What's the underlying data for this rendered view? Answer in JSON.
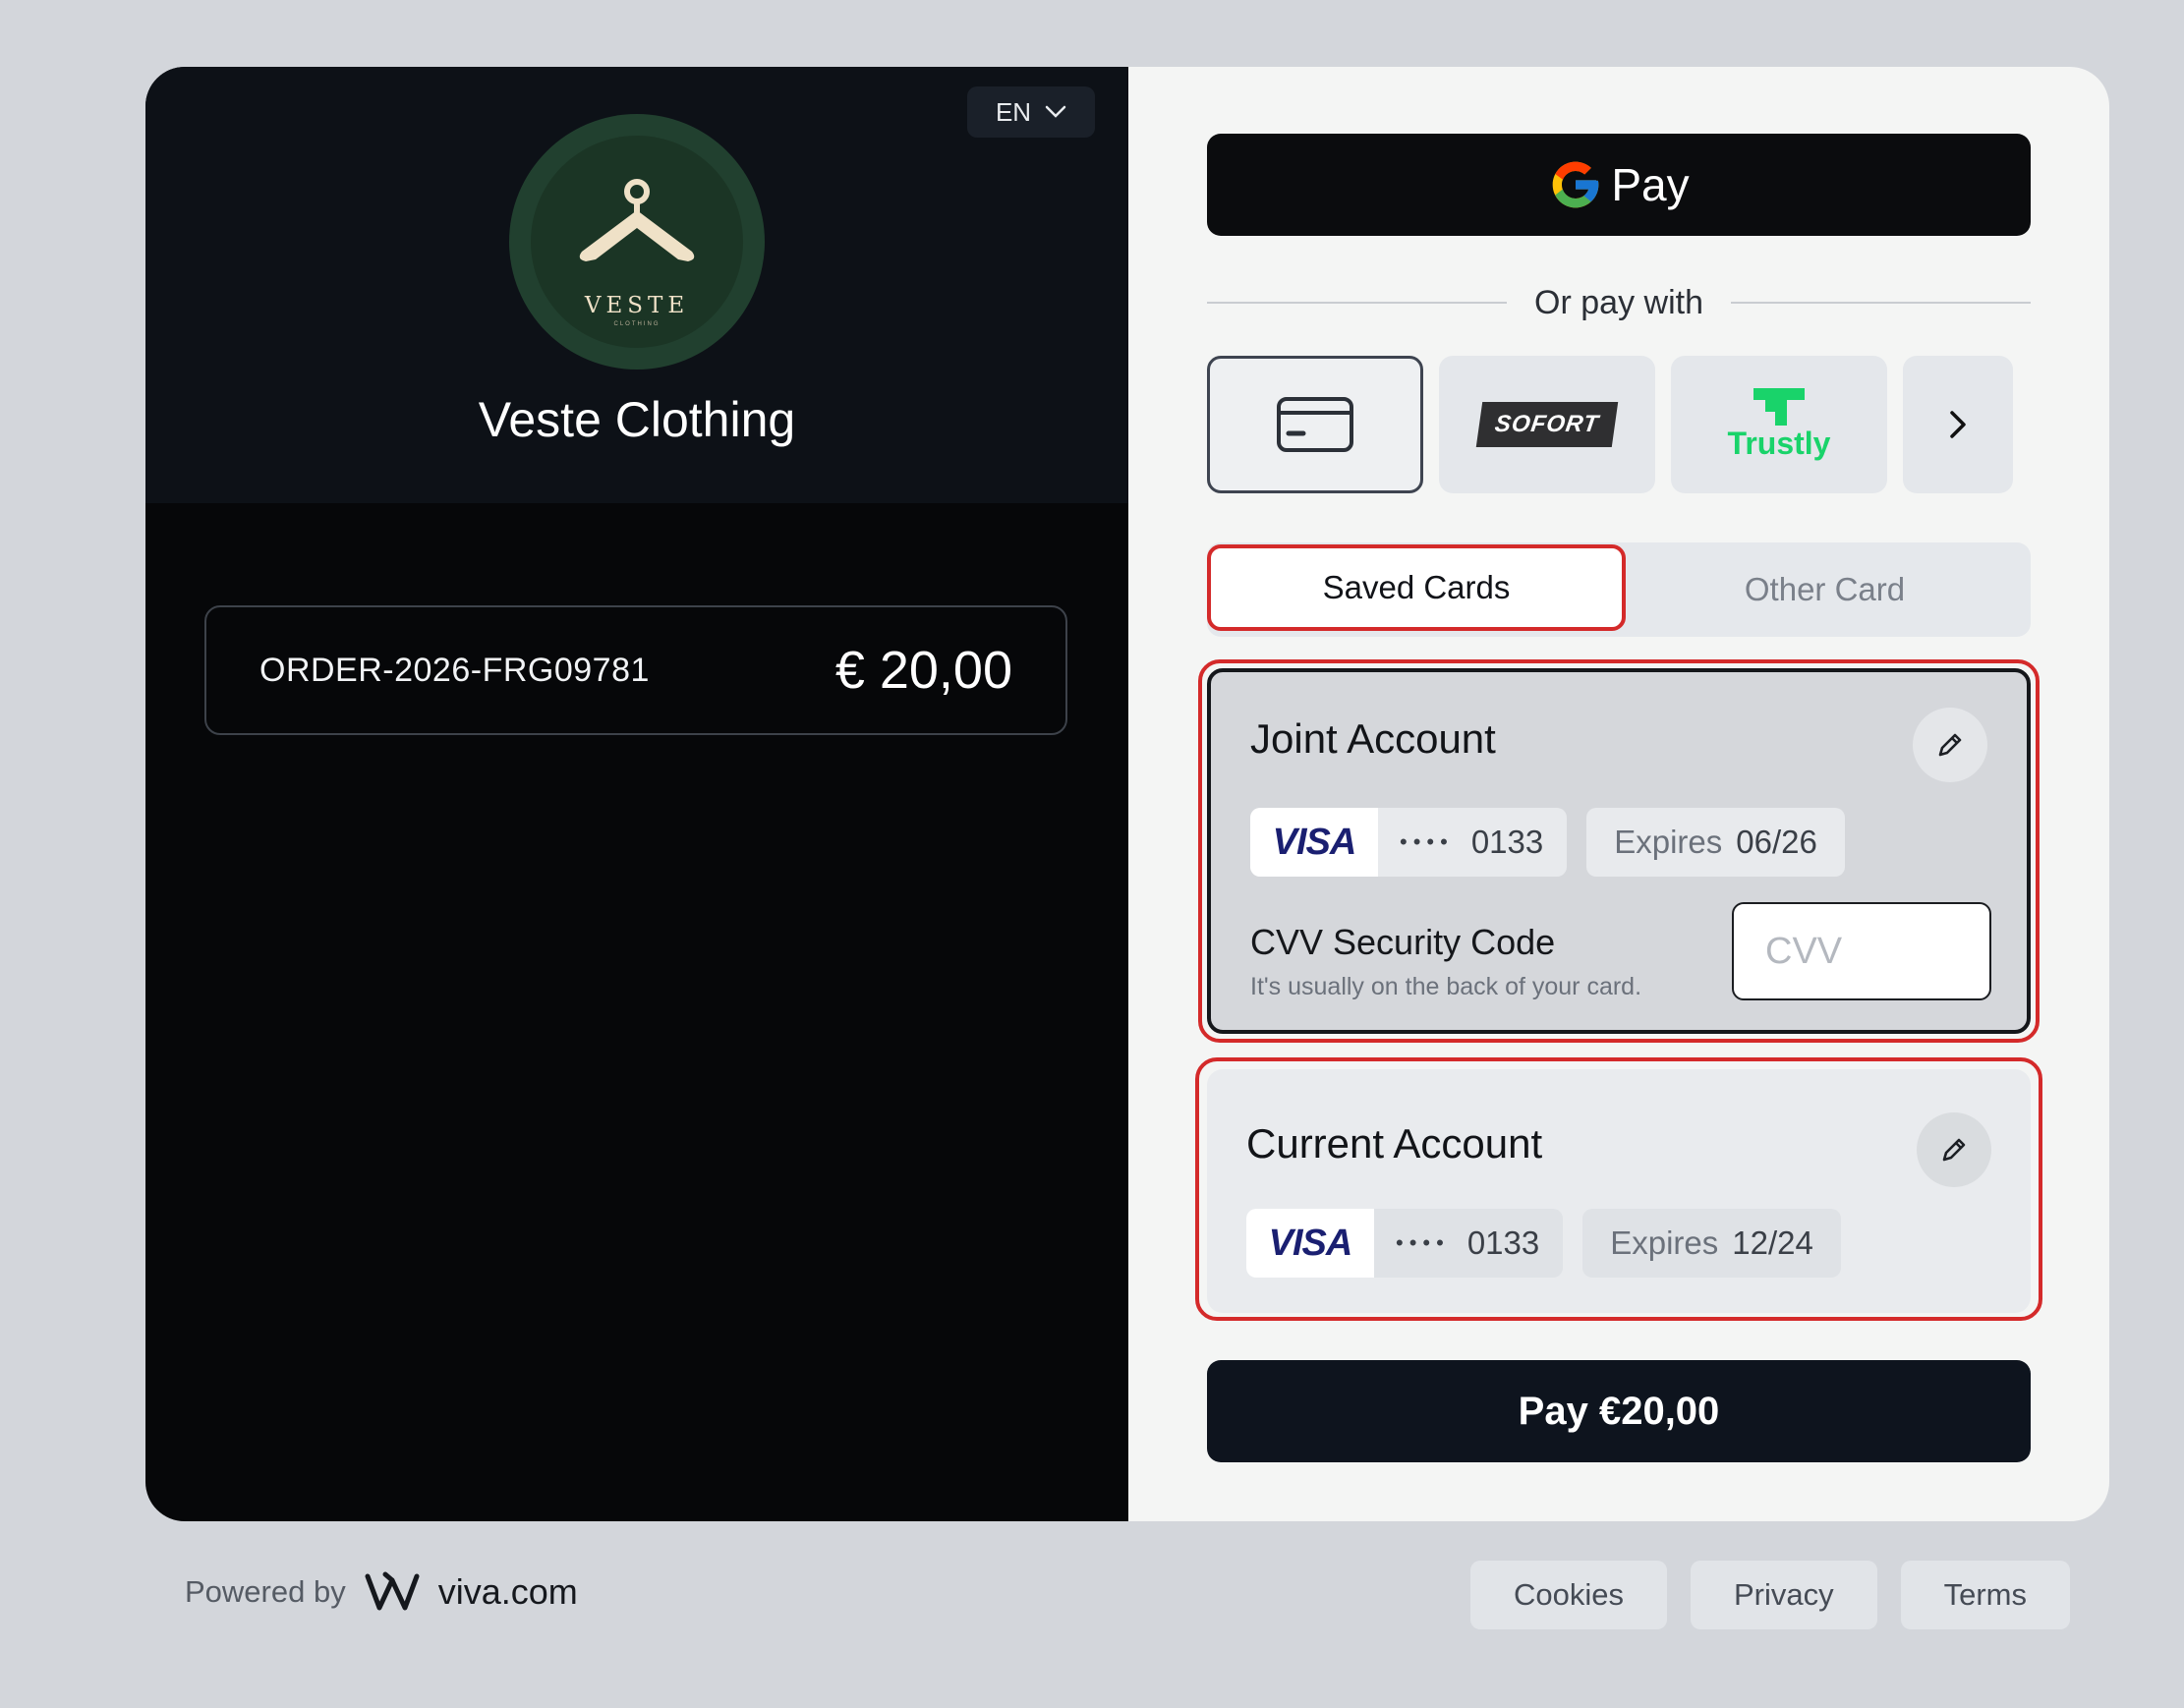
{
  "merchant": {
    "name": "Veste Clothing",
    "logo_word": "VESTE",
    "logo_sub": "CLOTHING",
    "language": "EN"
  },
  "order": {
    "id": "ORDER-2026-FRG09781",
    "amount": "€ 20,00"
  },
  "payment": {
    "gpay_label": "Pay",
    "divider_text": "Or pay with",
    "methods": [
      "card-icon",
      "SOFORT",
      "Trustly",
      "chevron-right-icon"
    ],
    "tabs": {
      "saved": "Saved Cards",
      "other": "Other Card"
    },
    "accounts": [
      {
        "name": "Joint Account",
        "brand": "VISA",
        "dots": "••••",
        "last4": "0133",
        "expires_label": "Expires",
        "expires": "06/26",
        "cvv_label": "CVV Security Code",
        "cvv_help": "It's usually on the back of your card.",
        "cvv_placeholder": "CVV"
      },
      {
        "name": "Current Account",
        "brand": "VISA",
        "dots": "••••",
        "last4": "0133",
        "expires_label": "Expires",
        "expires": "12/24"
      }
    ],
    "pay_button": "Pay €20,00"
  },
  "footer": {
    "powered_by": "Powered by",
    "brand": "viva.com",
    "links": [
      "Cookies",
      "Privacy",
      "Terms"
    ]
  },
  "colors": {
    "highlight": "#d42a2a",
    "trustly": "#19d36a",
    "visa": "#1a1f71"
  }
}
